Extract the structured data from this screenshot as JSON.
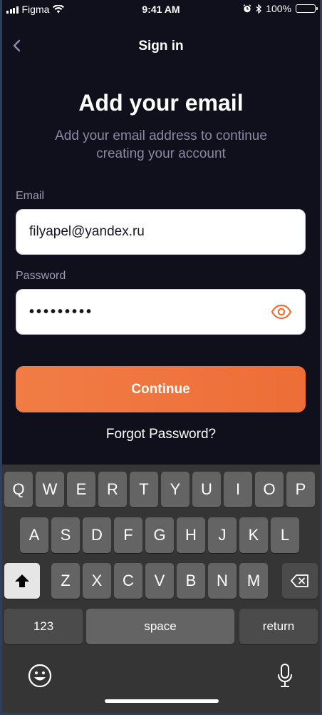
{
  "status_bar": {
    "carrier": "Figma",
    "time": "9:41 AM",
    "battery": "100%"
  },
  "nav": {
    "title": "Sign in"
  },
  "heading": "Add your email",
  "subtitle": "Add your email address to continue creating your account",
  "email": {
    "label": "Email",
    "value": "filyapel@yandex.ru"
  },
  "password": {
    "label": "Password",
    "masked_value": "•••••••••"
  },
  "continue_label": "Continue",
  "forgot_label": "Forgot Password?",
  "keyboard": {
    "row1": [
      "Q",
      "W",
      "E",
      "R",
      "T",
      "Y",
      "U",
      "I",
      "O",
      "P"
    ],
    "row2": [
      "A",
      "S",
      "D",
      "F",
      "G",
      "H",
      "J",
      "K",
      "L"
    ],
    "row3": [
      "Z",
      "X",
      "C",
      "V",
      "B",
      "N",
      "M"
    ],
    "numbers_label": "123",
    "space_label": "space",
    "return_label": "return"
  },
  "colors": {
    "background": "#100f1c",
    "accent": "#ee6d37",
    "muted_text": "#8a8aa3"
  },
  "icons": [
    "signal-icon",
    "wifi-icon",
    "alarm-icon",
    "bluetooth-icon",
    "battery-icon",
    "back-chevron-icon",
    "eye-icon",
    "shift-icon",
    "backspace-icon",
    "emoji-icon",
    "microphone-icon"
  ]
}
